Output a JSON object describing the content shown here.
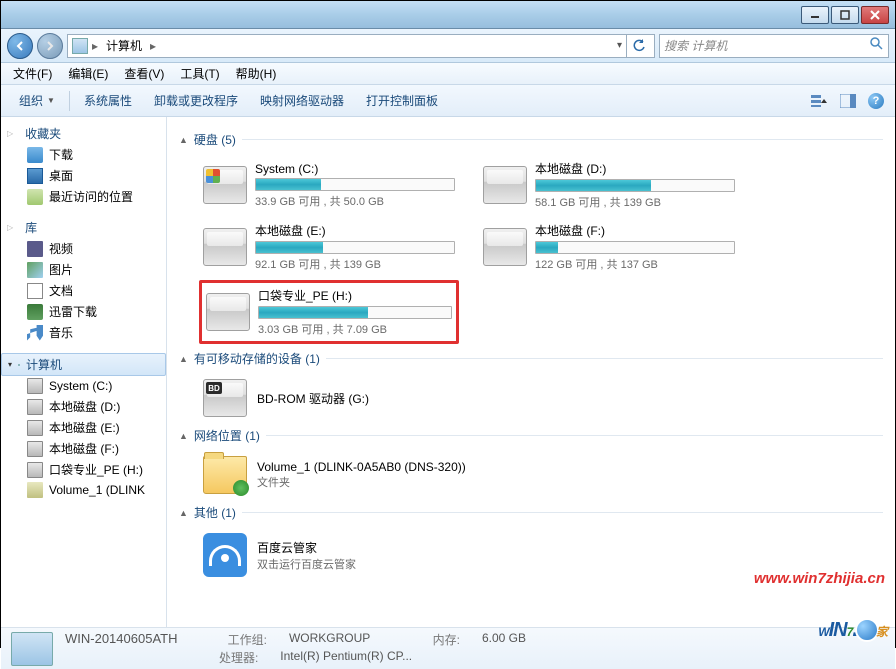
{
  "titlebar": {
    "min": "—",
    "max": "□",
    "close": "×"
  },
  "nav": {
    "address_root": "计算机",
    "address_sep": "▸",
    "search_placeholder": "搜索 计算机"
  },
  "menu": {
    "file": "文件(F)",
    "edit": "编辑(E)",
    "view": "查看(V)",
    "tools": "工具(T)",
    "help": "帮助(H)"
  },
  "toolbar": {
    "organize": "组织",
    "sys_props": "系统属性",
    "uninstall": "卸载或更改程序",
    "map_drive": "映射网络驱动器",
    "control_panel": "打开控制面板"
  },
  "sidebar": {
    "favorites": "收藏夹",
    "downloads": "下载",
    "desktop": "桌面",
    "recent": "最近访问的位置",
    "libraries": "库",
    "videos": "视频",
    "pictures": "图片",
    "documents": "文档",
    "xunlei": "迅雷下载",
    "music": "音乐",
    "computer": "计算机",
    "drives": [
      "System (C:)",
      "本地磁盘 (D:)",
      "本地磁盘 (E:)",
      "本地磁盘 (F:)",
      "口袋专业_PE (H:)",
      "Volume_1 (DLINK"
    ]
  },
  "content": {
    "group_hdd": "硬盘 (5)",
    "group_removable": "有可移动存储的设备 (1)",
    "group_network": "网络位置 (1)",
    "group_other": "其他 (1)",
    "drives": [
      {
        "name": "System (C:)",
        "stat": "33.9 GB 可用 , 共 50.0 GB",
        "pct": 33,
        "win": true
      },
      {
        "name": "本地磁盘 (D:)",
        "stat": "58.1 GB 可用 , 共 139 GB",
        "pct": 58
      },
      {
        "name": "本地磁盘 (E:)",
        "stat": "92.1 GB 可用 , 共 139 GB",
        "pct": 34
      },
      {
        "name": "本地磁盘 (F:)",
        "stat": "122 GB 可用 , 共 137 GB",
        "pct": 11
      },
      {
        "name": "口袋专业_PE (H:)",
        "stat": "3.03 GB 可用 , 共 7.09 GB",
        "pct": 57,
        "highlight": true
      }
    ],
    "bdrom": "BD-ROM 驱动器 (G:)",
    "netloc": {
      "name": "Volume_1 (DLINK-0A5AB0 (DNS-320))",
      "type": "文件夹"
    },
    "other": {
      "name": "百度云管家",
      "desc": "双击运行百度云管家"
    }
  },
  "status": {
    "name": "WIN-20140605ATH",
    "workgroup_lbl": "工作组:",
    "workgroup": "WORKGROUP",
    "mem_lbl": "内存:",
    "mem": "6.00 GB",
    "cpu_lbl": "处理器:",
    "cpu": "Intel(R) Pentium(R) CP..."
  },
  "watermark": "www.win7zhijia.cn",
  "logo": {
    "w": "W",
    "in": "IN",
    "seven": "7",
    "jia": "家"
  }
}
